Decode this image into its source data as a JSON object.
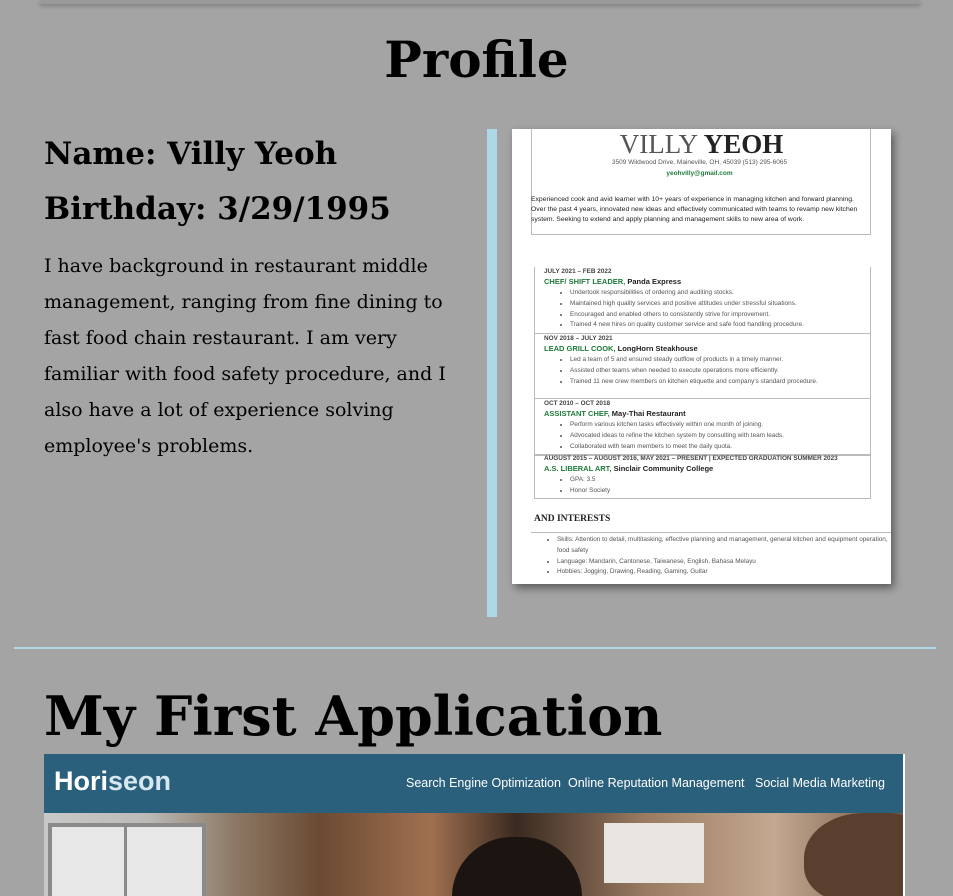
{
  "profile": {
    "heading": "Profile",
    "name_label": "Name: Villy Yeoh",
    "birthday_label": "Birthday: 3/29/1995",
    "bio": "I have background in restaurant middle management, ranging from fine dining to fast food chain restaurant. I am very familiar with food safety procedure, and I also have a lot of experience solving employee's problems."
  },
  "resume": {
    "first_name": "VILLY",
    "last_name": "YEOH",
    "address": "3509 Wildwood Drive, Maineville, OH, 45039  (513) 295-6065",
    "email": "yeohvilly@gmail.com",
    "summary": "Experienced cook and avid learner with 10+ years of experience in managing kitchen and forward planning. Over the past 4 years, innovated new ideas and effectively communicated with teams to revamp new kitchen system.  Seeking to extend and apply planning and management skills to new area of work.",
    "jobs": [
      {
        "date": "JULY 2021 – FEB 2022",
        "role": "CHEF/ SHIFT LEADER,",
        "company": "Panda Express",
        "bullets": [
          "Undertook responsibilities of ordering and auditing stocks.",
          "Maintained high quality services and positive attitudes under stressful situations.",
          "Encouraged and enabled others to consistently strive for improvement.",
          "Trained 4 new hires on quality customer service and safe food handling procedure."
        ]
      },
      {
        "date": "NOV 2018 – JULY 2021",
        "role": "LEAD GRILL COOK,",
        "company": "LongHorn Steakhouse",
        "bullets": [
          "Led a team of 5 and ensured steady outflow of products in a timely manner.",
          "Assisted other teams when needed to execute operations more efficiently.",
          "Trained 11 new crew members on kitchen etiquette and company's standard procedure."
        ]
      },
      {
        "date": "OCT 2010 – OCT 2018",
        "role": "ASSISTANT CHEF,",
        "company": "May-Thai Restaurant",
        "bullets": [
          "Perform various kitchen tasks effectively within one month of joining.",
          "Advocated ideas to refine the kitchen system by consulting with team leads.",
          "Collaborated with team members to meet the daily quota."
        ]
      },
      {
        "date": "AUGUST 2015 – AUGUST 2016, MAY 2021 – PRESENT | EXPECTED GRADUATION SUMMER 2023",
        "role": "A.S. LIBERAL ART,",
        "company": "Sinclair Community College",
        "bullets": [
          "GPA: 3.5",
          "Honor Society"
        ]
      }
    ],
    "interests_heading": "AND INTERESTS",
    "interests": [
      "Skills: Attention to detail, multitasking, effective planning and management, general kitchen and equipment operation, food safety",
      "Language: Mandarin, Cantonese, Taiwanese, English, Bahasa Melayu",
      "Hobbies: Jogging, Drawing, Reading, Gaming, Guitar"
    ]
  },
  "application": {
    "heading": "My First Application",
    "logo_main": "Hori",
    "logo_accent": "seon",
    "nav": [
      "Search Engine Optimization",
      "Online Reputation Management",
      "Social Media Marketing"
    ]
  },
  "colors": {
    "page_background": "#a4a4a4",
    "accent_light_blue": "#add8e6",
    "app_nav": "#2a607c",
    "resume_green": "#1e7b3a"
  }
}
